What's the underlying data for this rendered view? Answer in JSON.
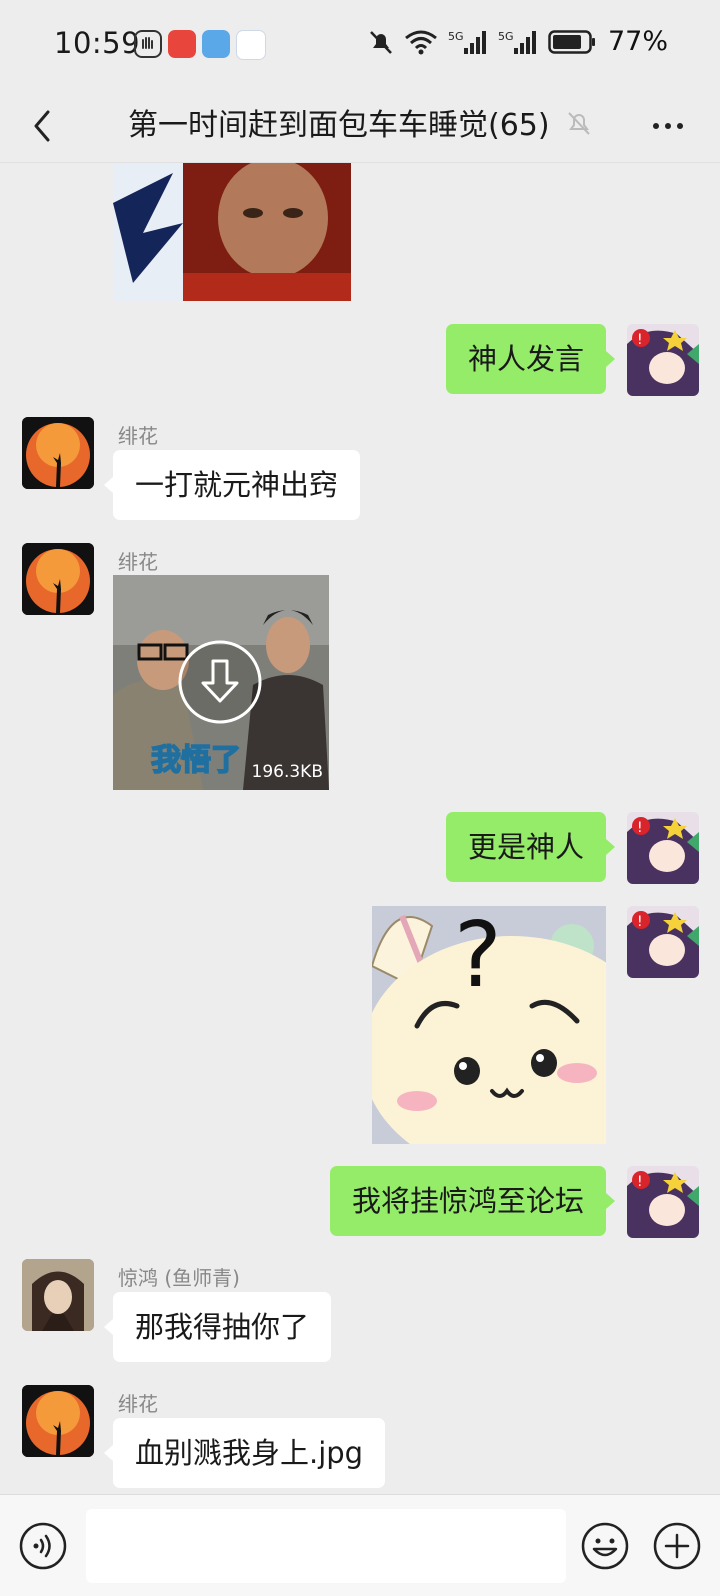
{
  "status": {
    "time": "10:59",
    "battery": "77%",
    "signal1": "5G",
    "signal2": "5G"
  },
  "header": {
    "title": "第一时间赶到面包车车睡觉(65)"
  },
  "messages": {
    "m1_text": "神人发言",
    "m2_sender": "绯花",
    "m2_text": "一打就元神出窍",
    "m3_sender": "绯花",
    "m3_size": "196.3KB",
    "m3_caption": "我悟了",
    "m4_text": "更是神人",
    "m6_text": "我将挂惊鸿至论坛",
    "m7_sender": "惊鸿 (鱼师青)",
    "m7_text": "那我得抽你了",
    "m8_sender": "绯花",
    "m8_text": "血别溅我身上.jpg"
  },
  "colors": {
    "bubble_out": "#95ec69",
    "bubble_in": "#ffffff",
    "background": "#ededed"
  },
  "icons": {
    "back": "chevron-left-icon",
    "mute": "bell-off-icon",
    "more": "more-dots-icon",
    "voice": "voice-icon",
    "emoji": "emoji-icon",
    "plus": "plus-icon"
  }
}
